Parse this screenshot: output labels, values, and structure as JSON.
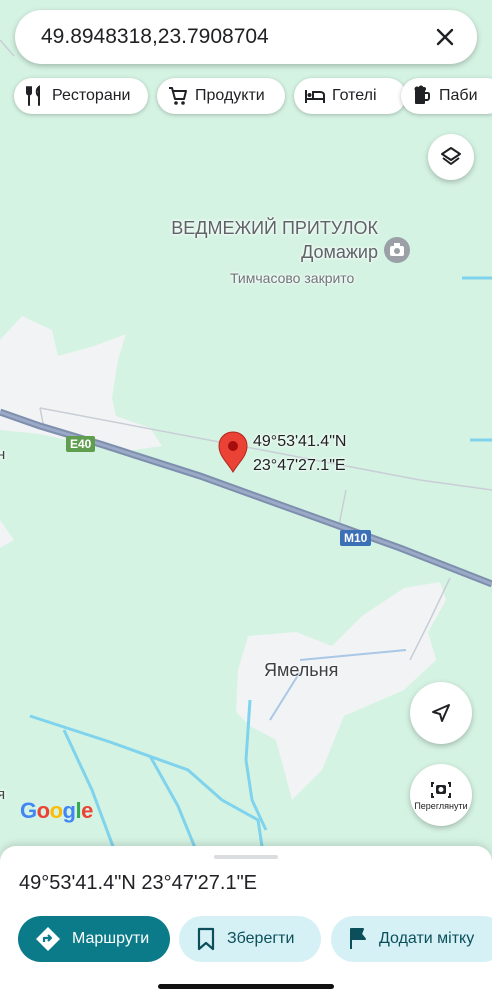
{
  "search": {
    "query": "49.8948318,23.7908704"
  },
  "chips": [
    {
      "label": "Ресторани",
      "icon": "restaurant-icon"
    },
    {
      "label": "Продукти",
      "icon": "cart-icon"
    },
    {
      "label": "Готелі",
      "icon": "bed-icon"
    },
    {
      "label": "Паби",
      "icon": "beer-icon"
    }
  ],
  "map": {
    "poi": {
      "name": "ВЕДМЕЖИЙ ПРИТУЛОК Домажир",
      "status": "Тимчасово закрито",
      "icon": "camera-icon"
    },
    "pin_coords": {
      "lat": "49°53'41.4\"N",
      "lng": "23°47'27.1\"E"
    },
    "village": "Ямельня",
    "road_shields": [
      {
        "label": "E40",
        "color": "#5f9e4f"
      },
      {
        "label": "M10",
        "color": "#3b6fb6"
      }
    ],
    "edge_letters": [
      "н",
      "я"
    ],
    "street_view_label": "Переглянути",
    "logo": "Google"
  },
  "sheet": {
    "title": "49°53'41.4\"N 23°47'27.1\"E",
    "directions_label": "Маршрути",
    "save_label": "Зберегти",
    "add_label_label": "Додати мітку"
  },
  "colors": {
    "map_bg": "#d5f3e3",
    "urban": "#f1f3f4",
    "road": "#8ea0bd",
    "water": "#7fd3ec",
    "pin": "#ea4335",
    "primary_button": "#0b7b8a",
    "tonal_button": "#d6f1f6"
  }
}
